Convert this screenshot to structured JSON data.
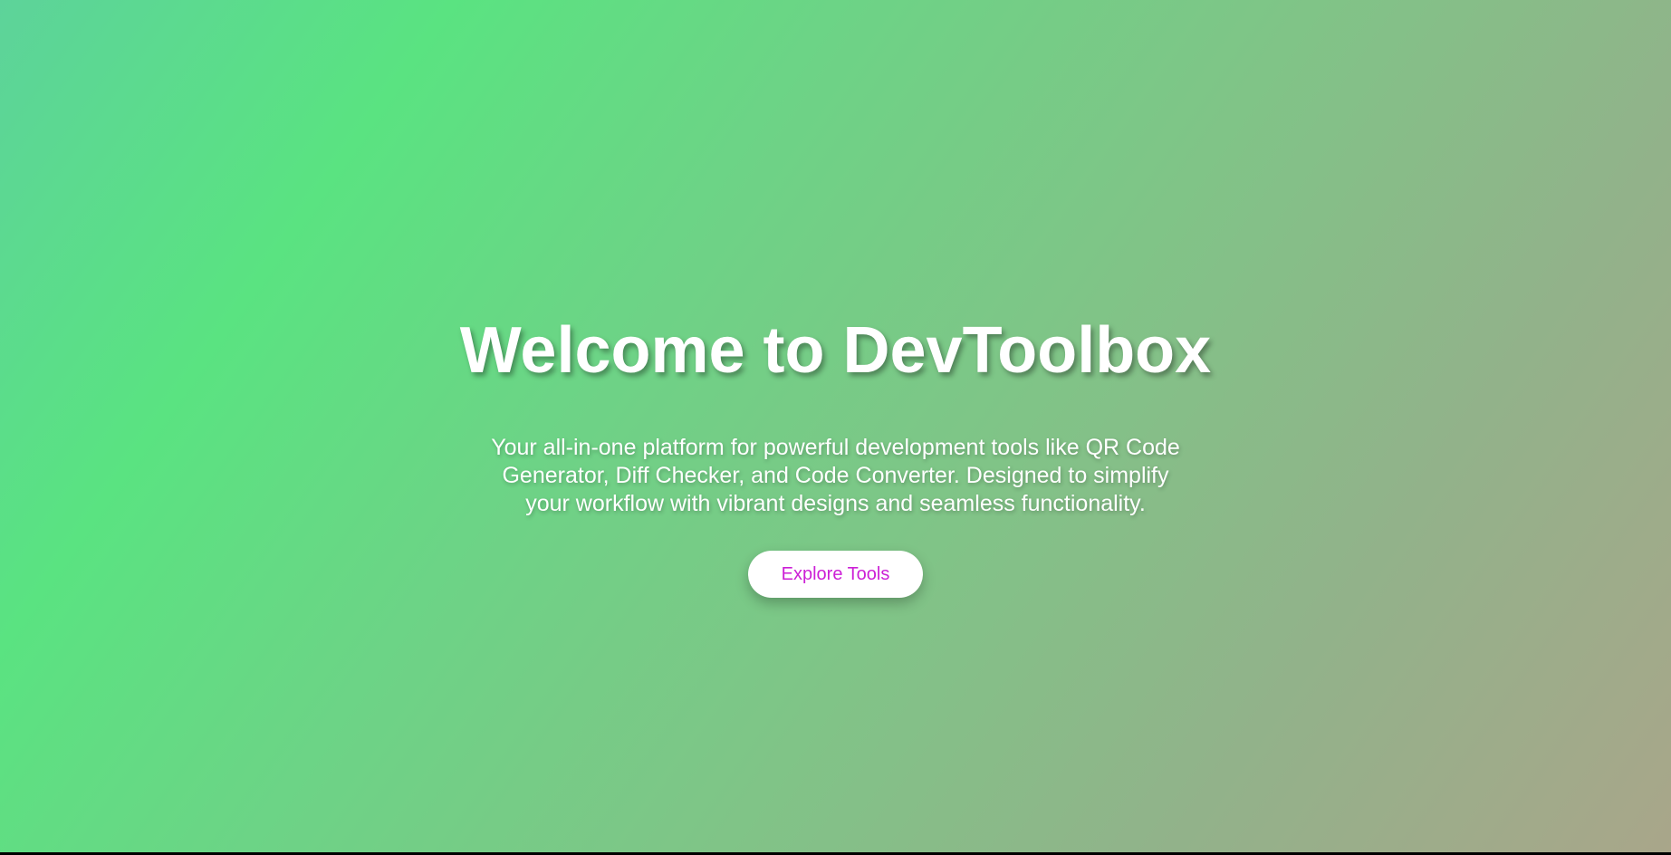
{
  "hero": {
    "title": "Welcome to DevToolbox",
    "subtitle": "Your all-in-one platform for powerful development tools like QR Code Generator, Diff Checker, and Code Converter. Designed to simplify your workflow with vibrant designs and seamless functionality.",
    "cta_label": "Explore Tools"
  },
  "colors": {
    "gradient_start": "#5ae381",
    "gradient_end": "#a9a68a",
    "button_text": "#cc1fd6",
    "button_bg": "#ffffff",
    "text": "#ffffff"
  }
}
